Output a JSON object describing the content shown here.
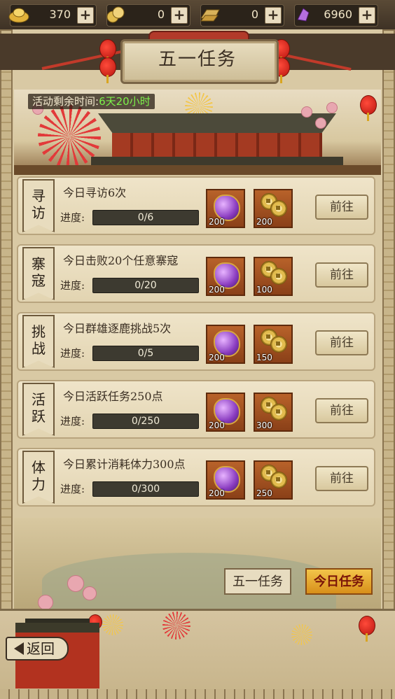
{
  "resources": [
    {
      "icon": "gold-ingot-icon",
      "value": "370"
    },
    {
      "icon": "coin-stack-icon",
      "value": "0"
    },
    {
      "icon": "silver-bar-icon",
      "value": "0"
    },
    {
      "icon": "purple-gem-icon",
      "value": "6960"
    }
  ],
  "title": "五一任务",
  "timer": {
    "label": "活动剩余时间:",
    "value": "6天20小时"
  },
  "tasks": [
    {
      "tag1": "寻",
      "tag2": "访",
      "desc": "今日寻访6次",
      "progress_label": "进度:",
      "progress": "0/6",
      "reward1": "200",
      "reward2": "200",
      "button": "前往"
    },
    {
      "tag1": "寨",
      "tag2": "寇",
      "desc": "今日击败20个任意寨寇",
      "progress_label": "进度:",
      "progress": "0/20",
      "reward1": "200",
      "reward2": "100",
      "button": "前往"
    },
    {
      "tag1": "挑",
      "tag2": "战",
      "desc": "今日群雄逐鹿挑战5次",
      "progress_label": "进度:",
      "progress": "0/5",
      "reward1": "200",
      "reward2": "150",
      "button": "前往"
    },
    {
      "tag1": "活",
      "tag2": "跃",
      "desc": "今日活跃任务250点",
      "progress_label": "进度:",
      "progress": "0/250",
      "reward1": "200",
      "reward2": "300",
      "button": "前往"
    },
    {
      "tag1": "体",
      "tag2": "力",
      "desc": "今日累计消耗体力300点",
      "progress_label": "进度:",
      "progress": "0/300",
      "reward1": "200",
      "reward2": "250",
      "button": "前往"
    }
  ],
  "tabs": {
    "tab1": "五一任务",
    "tab2": "今日任务"
  },
  "back": "返回",
  "colors": {
    "accent_tab": "#e8a22a",
    "timer_value": "#7cf24a",
    "frame": "#d9c9a4"
  }
}
